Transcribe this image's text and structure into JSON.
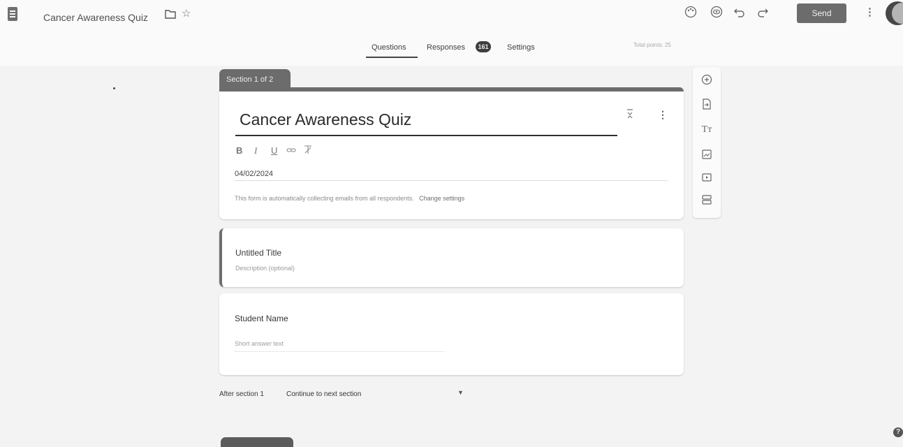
{
  "header": {
    "doc_title": "Cancer Awareness Quiz",
    "send_label": "Send",
    "icons": [
      "forms-app-icon",
      "folder-icon",
      "star-icon",
      "palette-icon",
      "preview-eye-icon",
      "undo-icon",
      "redo-icon",
      "more-vert-icon",
      "avatar"
    ]
  },
  "tabs": {
    "questions": "Questions",
    "responses": "Responses",
    "responses_count": "161",
    "settings": "Settings",
    "total_points": "Total points: 25"
  },
  "section": {
    "label": "Section 1 of 2",
    "title": "Cancer Awareness Quiz",
    "description": "04/02/2024",
    "email_notice": "This form is automatically collecting emails from all respondents.",
    "change_settings": "Change settings",
    "format_icons": [
      "bold-icon",
      "italic-icon",
      "underline-icon",
      "link-icon",
      "clear-format-icon"
    ]
  },
  "untitled": {
    "title": "Untitled Title",
    "description_placeholder": "Description (optional)"
  },
  "question": {
    "title": "Student Name",
    "placeholder": "Short answer text"
  },
  "after_section": {
    "label": "After section 1",
    "value": "Continue to next section"
  },
  "side_toolbar": {
    "icons": [
      "add-question-icon",
      "import-questions-icon",
      "add-title-icon",
      "add-image-icon",
      "add-video-icon",
      "add-section-icon"
    ]
  }
}
